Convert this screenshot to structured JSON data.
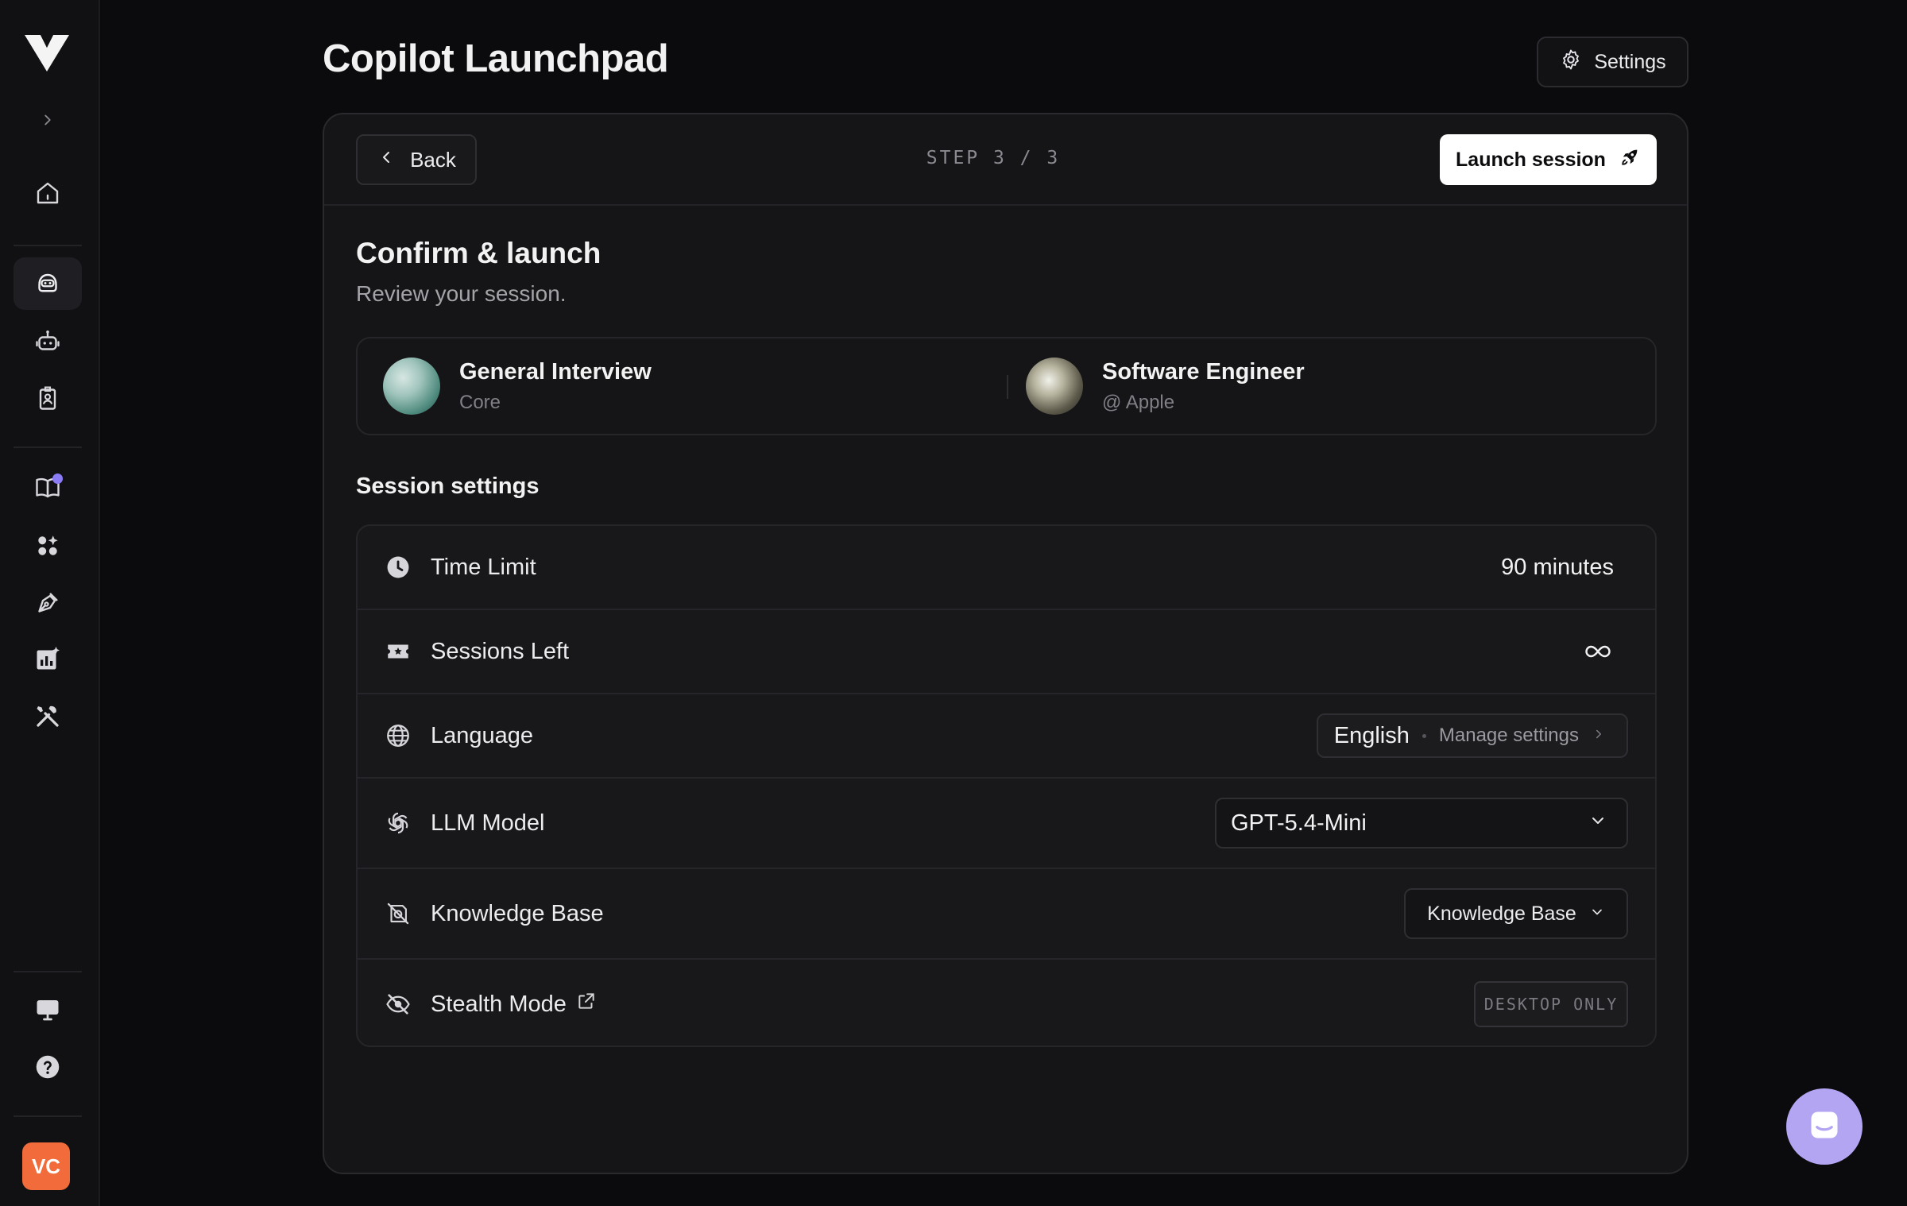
{
  "app": {
    "page_title": "Copilot Launchpad",
    "settings_label": "Settings"
  },
  "sidebar": {
    "items": [
      {
        "name": "expand",
        "icon": "chevron-right-icon"
      },
      {
        "name": "home",
        "icon": "home-icon"
      },
      {
        "name": "copilot",
        "icon": "copilot-icon",
        "active": true
      },
      {
        "name": "bot",
        "icon": "robot-icon"
      },
      {
        "name": "resume",
        "icon": "id-badge-icon"
      },
      {
        "name": "library",
        "icon": "book-icon",
        "badge": true
      },
      {
        "name": "apps",
        "icon": "apps-icon"
      },
      {
        "name": "design",
        "icon": "pen-tool-icon"
      },
      {
        "name": "analytics",
        "icon": "chart-icon"
      },
      {
        "name": "tools",
        "icon": "tools-icon"
      },
      {
        "name": "desktop",
        "icon": "monitor-icon"
      },
      {
        "name": "help",
        "icon": "help-icon"
      }
    ],
    "avatar_initials": "VC"
  },
  "wizard": {
    "back_label": "Back",
    "step_label": "STEP 3 / 3",
    "launch_label": "Launch session"
  },
  "confirm": {
    "heading": "Confirm & launch",
    "subheading": "Review your session."
  },
  "profiles": [
    {
      "title": "General Interview",
      "subtitle": "Core"
    },
    {
      "title": "Software Engineer",
      "subtitle": "@ Apple"
    }
  ],
  "session_settings": {
    "heading": "Session settings",
    "time_limit": {
      "label": "Time Limit",
      "value": "90 minutes"
    },
    "sessions_left": {
      "label": "Sessions Left",
      "value_icon": "infinity-icon"
    },
    "language": {
      "label": "Language",
      "value": "English",
      "manage_label": "Manage settings"
    },
    "llm_model": {
      "label": "LLM Model",
      "value": "GPT-5.4-Mini"
    },
    "knowledge_base": {
      "label": "Knowledge Base",
      "value": "Knowledge Base"
    },
    "stealth_mode": {
      "label": "Stealth Mode",
      "badge": "DESKTOP ONLY"
    }
  },
  "colors": {
    "background": "#0b0b0d",
    "card": "#151517",
    "accent": "#8b7cf6",
    "avatar": "#f26b3a",
    "chat_bubble": "#b3a5f2"
  }
}
